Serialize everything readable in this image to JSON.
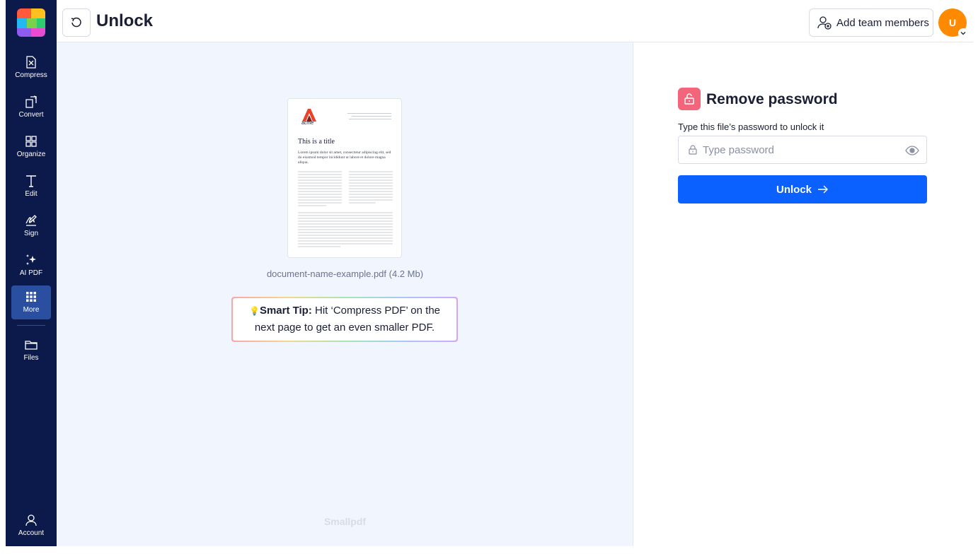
{
  "app": {
    "title": "Unlock",
    "brand_colors": {
      "sidebar": "#0c1a4b",
      "primary": "#0a61ff",
      "avatar": "#ff8a00",
      "unlock_icon_bg": "#f2657a"
    }
  },
  "sidebar": {
    "items": [
      {
        "label": "Compress",
        "icon": "compress-icon"
      },
      {
        "label": "Convert",
        "icon": "convert-icon"
      },
      {
        "label": "Organize",
        "icon": "organize-icon"
      },
      {
        "label": "Edit",
        "icon": "edit-icon"
      },
      {
        "label": "Sign",
        "icon": "sign-icon"
      },
      {
        "label": "AI PDF",
        "icon": "sparkle-icon"
      },
      {
        "label": "More",
        "icon": "grid-icon",
        "active": true
      },
      {
        "label": "Files",
        "icon": "folder-icon"
      }
    ],
    "account": {
      "label": "Account",
      "icon": "user-icon"
    }
  },
  "header": {
    "add_team_label": "Add team members",
    "avatar_initial": "U"
  },
  "preview": {
    "doc_brand": "acme",
    "doc_title": "This is a title",
    "doc_intro": "Lorem ipsum dolor sit amet, consectetur adipiscing elit, sed do eiusmod tempor incididunt ut labore et dolore magna aliqua.",
    "file_name": "document-name-example.pdf (4.2 Mb)",
    "smart_tip_label": "Smart Tip:",
    "smart_tip_text": " Hit ‘Compress PDF’ on the next page to get an even smaller PDF.",
    "watermark": "Smallpdf"
  },
  "panel": {
    "title": "Remove password",
    "field_label": "Type this file’s password to unlock it",
    "password_placeholder": "Type password",
    "password_value": "",
    "unlock_label": "Unlock"
  }
}
